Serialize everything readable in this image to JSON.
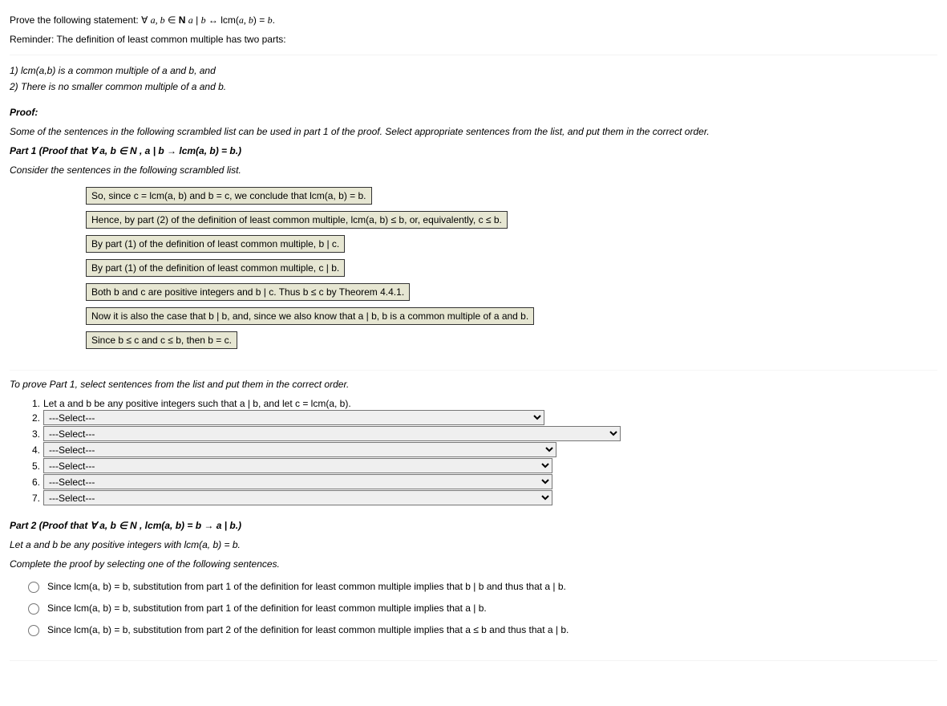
{
  "intro": {
    "statement_pre": "Prove the following statement: ∀ ",
    "statement_vars": "a, b",
    "statement_mid1": " ∈ ",
    "statement_N": "N",
    "statement_mid2": " ",
    "statement_a": "a",
    "statement_div": " | ",
    "statement_b": "b",
    "statement_iff": " ↔ lcm(",
    "statement_ab": "a, b",
    "statement_end": ") = ",
    "statement_b2": "b",
    "reminder": "Reminder: The definition of least common multiple has two parts:"
  },
  "defn": {
    "line1_pre": "1) lcm(a,b) is a common multiple of a and b, and",
    "line2": "2) There is no smaller common multiple of a and b."
  },
  "proof_label": "Proof:",
  "scramble_intro": "Some of the sentences in the following scrambled list can be used in part 1 of the proof. Select appropriate sentences from the list, and put them in the correct order.",
  "part1": {
    "heading_pre": "Part 1 (Proof that ∀ a, b ∈ N , a | b → lcm(a, b) = b.)",
    "consider": "Consider the sentences in the following scrambled list."
  },
  "scrambled": [
    "So, since c = lcm(a, b) and b = c, we conclude that lcm(a, b) = b.",
    "Hence, by part (2) of the definition of least common multiple, lcm(a, b) ≤ b, or, equivalently, c ≤ b.",
    "By part (1) of the definition of least common multiple, b | c.",
    "By part (1) of the definition of least common multiple, c | b.",
    "Both b and c are positive integers and b | c. Thus b ≤ c by Theorem 4.4.1.",
    "Now it is also the case that b | b, and, since we also know that a | b, b is a common multiple of a and b.",
    "Since b ≤ c and c ≤ b, then b = c."
  ],
  "order_intro": "To prove Part 1, select sentences from the list and put them in the correct order.",
  "step1": "Let a and b be any positive integers such that a | b, and let c = lcm(a, b).",
  "nums": [
    "1.",
    "2.",
    "3.",
    "4.",
    "5.",
    "6.",
    "7."
  ],
  "select_placeholder": "---Select---",
  "part2": {
    "heading": "Part 2 (Proof that ∀ a, b ∈ N , lcm(a, b) = b → a | b.)",
    "let": "Let a and b be any positive integers with lcm(a, b) = b.",
    "complete": "Complete the proof by selecting one of the following sentences."
  },
  "radios": [
    "Since lcm(a, b) = b, substitution from part 1 of the definition for least common multiple implies that b | b and thus that a | b.",
    "Since lcm(a, b) = b, substitution from part 1 of the definition for least common multiple implies that a | b.",
    "Since lcm(a, b) = b, substitution from part 2 of the definition for least common multiple implies that a ≤ b and thus that a | b."
  ]
}
